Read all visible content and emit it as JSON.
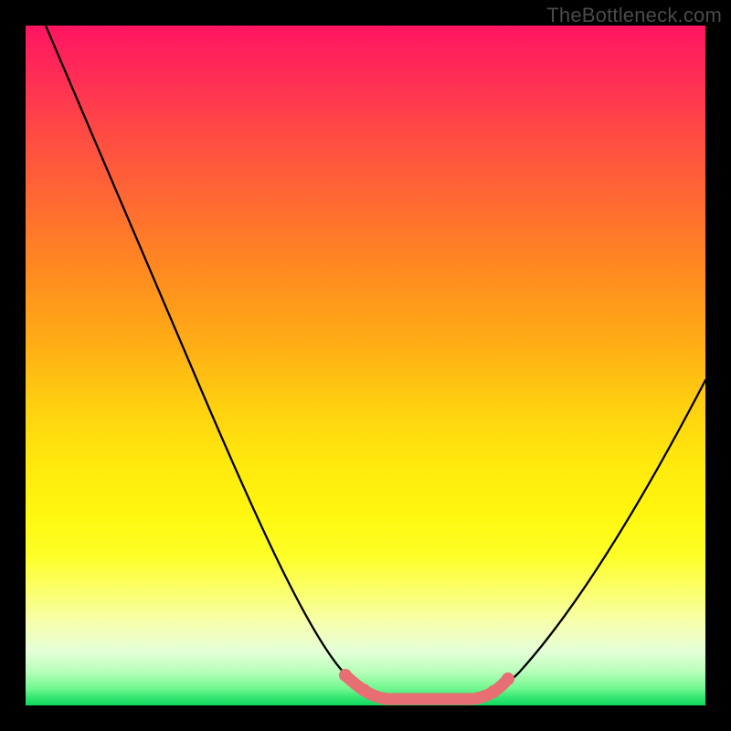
{
  "watermark": "TheBottleneck.com",
  "chart_data": {
    "type": "line",
    "title": "",
    "xlabel": "",
    "ylabel": "",
    "xlim": [
      0,
      100
    ],
    "ylim": [
      0,
      100
    ],
    "x": [
      3,
      10,
      20,
      30,
      40,
      48,
      52,
      56,
      60,
      64,
      68,
      76,
      84,
      92,
      100
    ],
    "values": [
      100,
      86,
      66,
      47,
      29,
      12,
      4,
      1,
      0.5,
      0.5,
      1,
      6,
      18,
      34,
      52
    ],
    "flat_region": {
      "x_start": 56,
      "x_end": 66,
      "y": 0.5
    },
    "pink_band": {
      "x_start": 48,
      "x_end": 68,
      "y": 1.2
    },
    "gradient_stops": [
      {
        "pos": 0,
        "color": "#ff1462"
      },
      {
        "pos": 50,
        "color": "#ffd010"
      },
      {
        "pos": 80,
        "color": "#feff28"
      },
      {
        "pos": 100,
        "color": "#0fd95e"
      }
    ]
  }
}
